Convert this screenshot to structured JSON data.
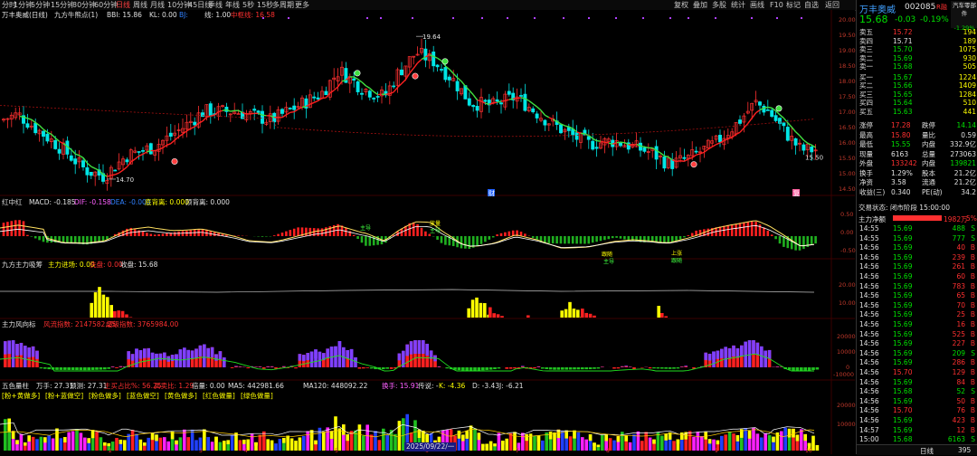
{
  "toolbar": {
    "periods": [
      "分时",
      "1分钟",
      "5分钟",
      "15分钟",
      "30分钟",
      "60分钟",
      "日线",
      "周线",
      "月线",
      "10分钟",
      "45日线",
      "季线",
      "年线",
      "5秒",
      "15秒",
      "多周期",
      "更多"
    ],
    "active_period": "日线",
    "right_tools": [
      "复权",
      "叠加",
      "多股",
      "统计",
      "画线",
      "F10",
      "标记",
      "自选",
      "返回"
    ]
  },
  "main_chart": {
    "stock_title": "万丰奥威(日线)",
    "indicator_name": "九方牛熊点(1)",
    "indicator_label_bbi": "BBI: 15.86",
    "indicator_label_kl": "KL: 0.00",
    "indicator_label_bj": "BJ:",
    "indicator_label_xian": "线: 1.00",
    "indicator_label_zhongfu": "中枢线: 16.58",
    "price_high": "19.64",
    "price_low": "14.70",
    "price_last_marker": "15.50",
    "marker_cai": "财",
    "marker_fu": "复",
    "y_labels": [
      "20.00",
      "19.50",
      "19.00",
      "18.50",
      "18.00",
      "17.50",
      "17.00",
      "16.50",
      "16.00",
      "15.50",
      "15.00",
      "14.50"
    ]
  },
  "macd_panel": {
    "title": "红中红",
    "macd": "MACD: -0.185",
    "dif": "DIF: -0.158",
    "dea": "DEA: -0.000",
    "extra1": "底背离: 0.000",
    "extra2": "顶背离: 0.000",
    "y_labels": [
      "0.50",
      "0.00",
      "-0.50"
    ],
    "signal_labels": [
      "主导",
      "放量",
      "主导",
      "跟随",
      "主导",
      "上涨",
      "跟随",
      "主导"
    ]
  },
  "jf_panel": {
    "title": "九方主力吸筹",
    "line1": "主力进场: 0.00",
    "line2": "洗盘: 0.00",
    "line3": "收盘: 15.68",
    "y_labels": [
      "20.00",
      "10.00"
    ]
  },
  "flow_panel": {
    "title": "主力风向标",
    "line1": "风流指数: 2147582.25",
    "line2": "超级指数: 3765984.00",
    "y_labels": [
      "20000",
      "10000",
      "0",
      "-10000"
    ]
  },
  "vol_panel": {
    "title": "五色量柱",
    "line1": "万手: 27.31",
    "line2": "预测: 27.31",
    "line3": "主买占比%: 56.25",
    "line4": "买卖比: 1.29",
    "line5": "倍量: 0.00",
    "line6": "倍量: 0.00",
    "line7": "MA5: 442981.66",
    "line8": "MA120: 448092.22",
    "line9": "换手: 15.91",
    "line10": "传说: -",
    "line11": "K: -4.36",
    "line12": "D: -3.43",
    "line13": "J: -6.21",
    "tags": [
      "[粉+黄做多]",
      "[粉+蓝做空]",
      "[粉色做多]",
      "[蓝色做空]",
      "[黄色做多]",
      "[红色做量]",
      "[绿色做量]"
    ],
    "y_labels": [
      "20000",
      "10000"
    ],
    "date_label": "2025/09/22/一",
    "month_labels": [
      "2",
      "3",
      "4",
      "5",
      "6",
      "7",
      "8",
      "9",
      "10"
    ]
  },
  "rpanel": {
    "name": "万丰奥威",
    "code": "002085",
    "tag": "R融",
    "sector": "汽车零部件",
    "sector_pct": "-1.29%",
    "price": "15.68",
    "change": "-0.03",
    "pct": "-0.19%",
    "asks": [
      {
        "label": "卖五",
        "price": "15.72",
        "vol": "194"
      },
      {
        "label": "卖四",
        "price": "15.71",
        "vol": "189"
      },
      {
        "label": "卖三",
        "price": "15.70",
        "vol": "1075"
      },
      {
        "label": "卖二",
        "price": "15.69",
        "vol": "930"
      },
      {
        "label": "卖一",
        "price": "15.68",
        "vol": "505"
      }
    ],
    "bids": [
      {
        "label": "买一",
        "price": "15.67",
        "vol": "1224"
      },
      {
        "label": "买二",
        "price": "15.66",
        "vol": "1409"
      },
      {
        "label": "买三",
        "price": "15.65",
        "vol": "1284"
      },
      {
        "label": "买四",
        "price": "15.64",
        "vol": "510"
      },
      {
        "label": "买五",
        "price": "15.63",
        "vol": "441"
      }
    ],
    "stats": [
      {
        "k1": "涨停",
        "v1": "17.28",
        "k2": "跌停",
        "v2": "14.14"
      },
      {
        "k1": "最高",
        "v1": "15.80",
        "k2": "量比",
        "v2": "0.59"
      },
      {
        "k1": "最低",
        "v1": "15.55",
        "k2": "内盘",
        "v2": "332.9亿"
      },
      {
        "k1": "现量",
        "v1": "6163",
        "k2": "总量",
        "v2": "273063"
      },
      {
        "k1": "外盘",
        "v1": "133242",
        "k2": "内盘",
        "v2": "139821"
      },
      {
        "k1": "换手",
        "v1": "1.29%",
        "k2": "股本",
        "v2": "21.2亿"
      },
      {
        "k1": "净资",
        "v1": "3.58",
        "k2": "流通",
        "v2": "21.2亿"
      },
      {
        "k1": "收益(三)",
        "v1": "0.340",
        "k2": "PE(动)",
        "v2": "34.2"
      }
    ],
    "trade_status": "交易状态: 闭市阶段 15:00:00",
    "mainforce_label": "主力净额",
    "mainforce_value": "1982万",
    "mainforce_pct": "5%",
    "ticks": [
      {
        "t": "14:55",
        "p": "15.69",
        "v": "488",
        "d": "S"
      },
      {
        "t": "14:55",
        "p": "15.69",
        "v": "777",
        "d": "S"
      },
      {
        "t": "14:56",
        "p": "15.69",
        "v": "40",
        "d": "B"
      },
      {
        "t": "14:56",
        "p": "15.69",
        "v": "239",
        "d": "B"
      },
      {
        "t": "14:56",
        "p": "15.69",
        "v": "261",
        "d": "B"
      },
      {
        "t": "14:56",
        "p": "15.69",
        "v": "60",
        "d": "B"
      },
      {
        "t": "14:56",
        "p": "15.69",
        "v": "783",
        "d": "B"
      },
      {
        "t": "14:56",
        "p": "15.69",
        "v": "65",
        "d": "B"
      },
      {
        "t": "14:56",
        "p": "15.69",
        "v": "70",
        "d": "B"
      },
      {
        "t": "14:56",
        "p": "15.69",
        "v": "25",
        "d": "B"
      },
      {
        "t": "14:56",
        "p": "15.69",
        "v": "16",
        "d": "B"
      },
      {
        "t": "14:56",
        "p": "15.69",
        "v": "525",
        "d": "B"
      },
      {
        "t": "14:56",
        "p": "15.69",
        "v": "227",
        "d": "B"
      },
      {
        "t": "14:56",
        "p": "15.69",
        "v": "209",
        "d": "S"
      },
      {
        "t": "14:56",
        "p": "15.69",
        "v": "286",
        "d": "B"
      },
      {
        "t": "14:56",
        "p": "15.70",
        "v": "129",
        "d": "B"
      },
      {
        "t": "14:56",
        "p": "15.69",
        "v": "84",
        "d": "B"
      },
      {
        "t": "14:56",
        "p": "15.68",
        "v": "52",
        "d": "S"
      },
      {
        "t": "14:56",
        "p": "15.69",
        "v": "50",
        "d": "B"
      },
      {
        "t": "14:56",
        "p": "15.70",
        "v": "76",
        "d": "B"
      },
      {
        "t": "14:56",
        "p": "15.69",
        "v": "423",
        "d": "B"
      },
      {
        "t": "14:57",
        "p": "15.69",
        "v": "12",
        "d": "B"
      },
      {
        "t": "15:00",
        "p": "15.68",
        "v": "6163",
        "d": "S"
      }
    ],
    "footer_tab": "日线",
    "footer_num": "395"
  },
  "colors": {
    "up": "#ff3030",
    "down": "#00e5e5",
    "text": "#c8c8c8",
    "accent": "#ffcc00"
  }
}
